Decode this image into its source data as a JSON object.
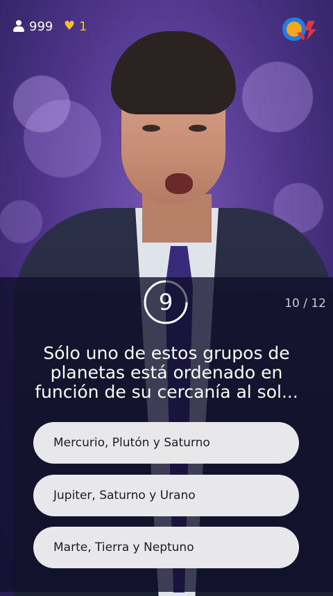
{
  "header": {
    "viewers": "999",
    "lives": "1",
    "icons": {
      "viewers": "user-icon",
      "lives": "heart-icon",
      "logo": "q12-logo"
    },
    "colors": {
      "lives": "#f3c12a",
      "logo_blue": "#1e7fe0",
      "logo_orange": "#f5a623",
      "logo_red": "#e5333b"
    }
  },
  "game": {
    "timer": "9",
    "timer_remaining_fraction": 0.75,
    "progress": "10 / 12",
    "question": "Sólo uno de estos grupos de planetas está ordenado en función de su cercanía al sol...",
    "answers": [
      {
        "label": "Mercurio, Plutón y Saturno"
      },
      {
        "label": "Jupiter, Saturno y Urano"
      },
      {
        "label": "Marte, Tierra y Neptuno"
      }
    ]
  }
}
